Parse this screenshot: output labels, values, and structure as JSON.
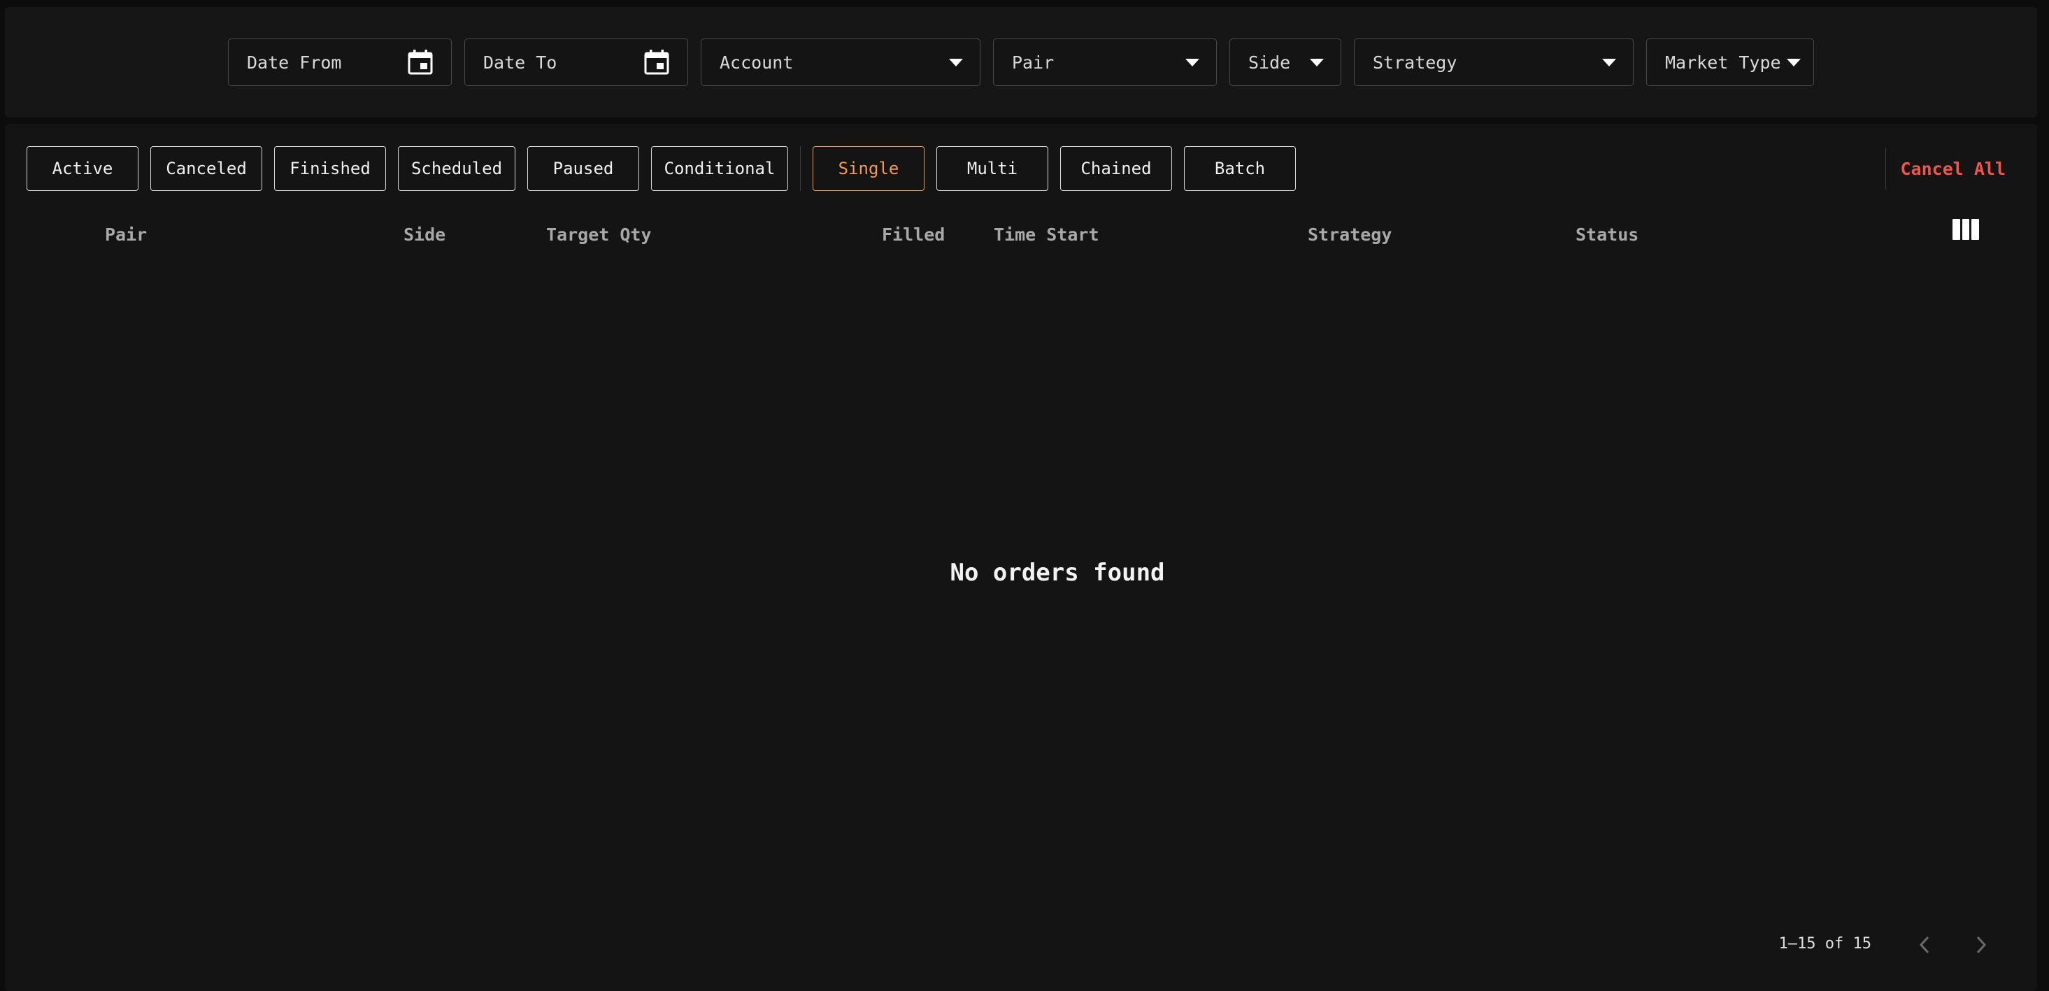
{
  "filters": {
    "date_from": "Date From",
    "date_to": "Date To",
    "account": "Account",
    "pair": "Pair",
    "side": "Side",
    "strategy": "Strategy",
    "market_type": "Market Type"
  },
  "status_tabs": [
    "Active",
    "Canceled",
    "Finished",
    "Scheduled",
    "Paused",
    "Conditional"
  ],
  "type_tabs": [
    "Single",
    "Multi",
    "Chained",
    "Batch"
  ],
  "selected_type_tab": "Single",
  "cancel_all": "Cancel All",
  "table": {
    "columns": [
      "Pair",
      "Side",
      "Target Qty",
      "Filled",
      "Time Start",
      "Strategy",
      "Status"
    ]
  },
  "empty_message": "No orders found",
  "pagination": {
    "range": "1–15 of 15"
  },
  "colors": {
    "accent": "#f39a4b",
    "danger": "#f0554a",
    "background": "#141414"
  },
  "icons": {
    "date_picker": "calendar-icon",
    "dropdown": "caret-down-icon",
    "columns": "columns-icon",
    "prev": "chevron-left-icon",
    "next": "chevron-right-icon"
  }
}
